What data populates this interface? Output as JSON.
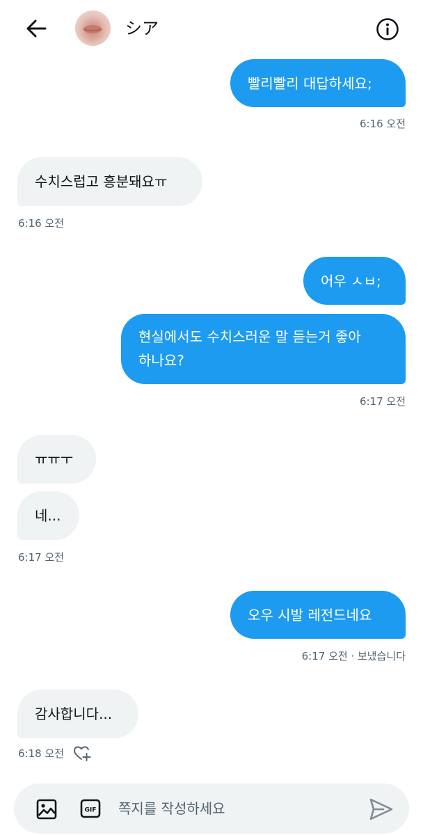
{
  "header": {
    "contact_name": "シア",
    "back_icon": "arrow-left-icon",
    "info_icon": "info-circle-icon"
  },
  "messages": [
    {
      "direction": "outgoing",
      "text": "빨리빨리 대답하세요;"
    },
    {
      "direction": "incoming",
      "text": "수치스럽고 흥분돼요ㅠ"
    },
    {
      "direction": "outgoing",
      "text": "어우 ㅅㅂ;"
    },
    {
      "direction": "outgoing",
      "text": "현실에서도 수치스러운 말 듣는거 좋아\n하나요?"
    },
    {
      "direction": "incoming",
      "text": "ㅠㅠㅜ"
    },
    {
      "direction": "incoming",
      "text": "네..."
    },
    {
      "direction": "outgoing",
      "text": "오우 시발 레전드네요"
    },
    {
      "direction": "incoming",
      "text": "감사합니다..."
    }
  ],
  "timestamps": [
    "6:16 오전",
    "6:16 오전",
    "6:17 오전",
    "6:17 오전",
    "6:17 오전 · 보냈습니다",
    "6:18 오전"
  ],
  "reaction_icon": "heart-plus-icon",
  "composer": {
    "placeholder": "쪽지를 작성하세요",
    "media_icon": "image-icon",
    "gif_icon": "gif-icon",
    "send_icon": "send-icon"
  },
  "colors": {
    "accent": "#1d9bf0",
    "incoming_bubble": "#eff3f4",
    "secondary_text": "#536471"
  }
}
